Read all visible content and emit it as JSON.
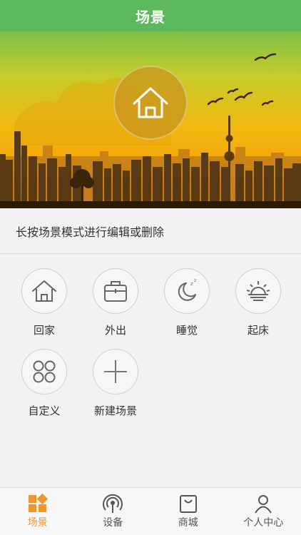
{
  "header": {
    "title": "场景"
  },
  "hint": "长按场景模式进行编辑或删除",
  "scenes": [
    {
      "label": "回家",
      "icon": "home-icon"
    },
    {
      "label": "外出",
      "icon": "briefcase-icon"
    },
    {
      "label": "睡觉",
      "icon": "moon-sleep-icon"
    },
    {
      "label": "起床",
      "icon": "sunrise-icon"
    },
    {
      "label": "自定义",
      "icon": "four-circles-icon"
    },
    {
      "label": "新建场景",
      "icon": "plus-icon"
    }
  ],
  "tabs": [
    {
      "label": "场景",
      "icon": "scene-grid-icon",
      "active": true
    },
    {
      "label": "设备",
      "icon": "device-signal-icon",
      "active": false
    },
    {
      "label": "商城",
      "icon": "shopping-bag-icon",
      "active": false
    },
    {
      "label": "个人中心",
      "icon": "person-icon",
      "active": false
    }
  ],
  "colors": {
    "header": "#5cb85c",
    "accent": "#f0962e"
  }
}
